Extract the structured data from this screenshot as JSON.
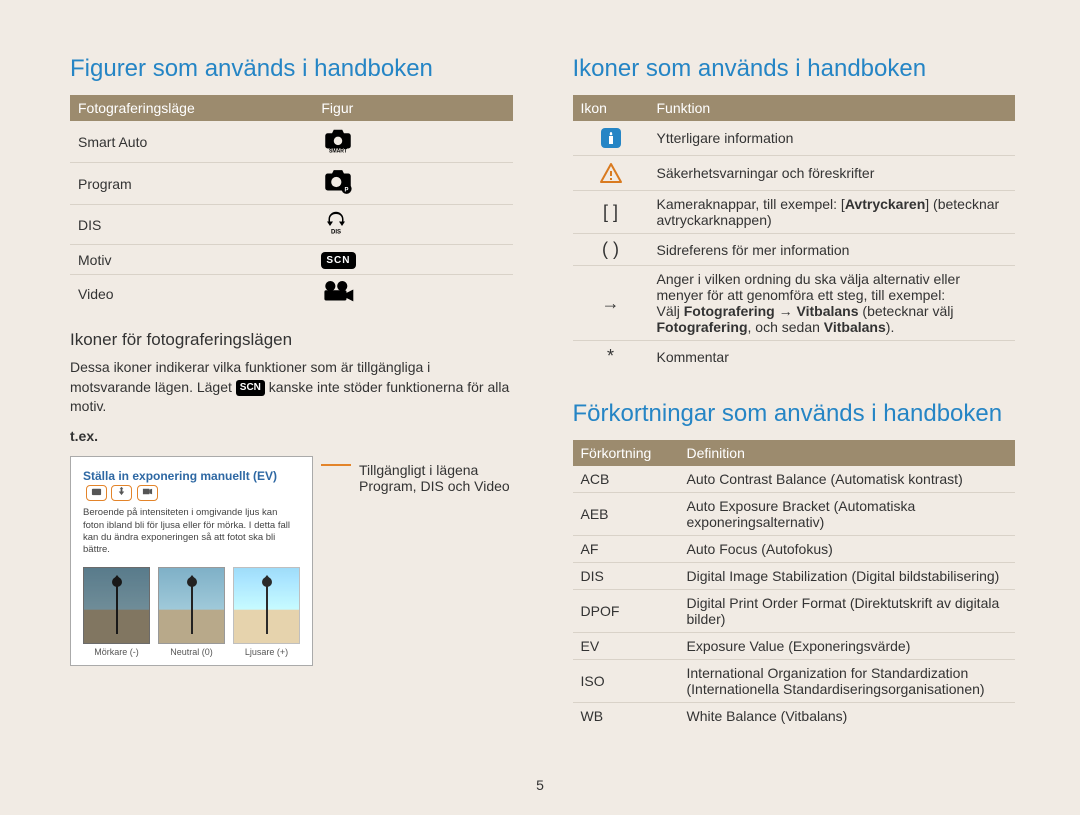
{
  "pageNumber": "5",
  "left": {
    "heading": "Figurer som används i handboken",
    "table1": {
      "headers": [
        "Fotograferingsläge",
        "Figur"
      ],
      "rows": [
        {
          "mode": "Smart Auto",
          "figKey": "smart"
        },
        {
          "mode": "Program",
          "figKey": "program"
        },
        {
          "mode": "DIS",
          "figKey": "dis"
        },
        {
          "mode": "Motiv",
          "figKey": "scn"
        },
        {
          "mode": "Video",
          "figKey": "video"
        }
      ]
    },
    "subheading": "Ikoner för fotograferingslägen",
    "paragraph_before": "Dessa ikoner indikerar vilka funktioner som är tillgängliga i motsvarande lägen. Läget ",
    "paragraph_scn_chip": "SCN",
    "paragraph_after": " kanske inte stöder funktionerna för alla motiv.",
    "example_label": "t.ex.",
    "example": {
      "title": "Ställa in exponering manuellt (EV)",
      "desc": "Beroende på intensiteten i omgivande ljus kan foton ibland bli för ljusa eller för mörka. I detta fall kan du ändra exponeringen så att fotot ska bli bättre.",
      "thumbs": [
        {
          "label": "Mörkare (-)"
        },
        {
          "label": "Neutral (0)"
        },
        {
          "label": "Ljusare (+)"
        }
      ]
    },
    "callout": "Tillgängligt i lägena Program, DIS och Video"
  },
  "right": {
    "heading1": "Ikoner som används i handboken",
    "iconTable": {
      "headers": [
        "Ikon",
        "Funktion"
      ],
      "rows": [
        {
          "iconKey": "info",
          "text": "Ytterligare information"
        },
        {
          "iconKey": "warn",
          "text": "Säkerhetsvarningar och föreskrifter"
        },
        {
          "iconKey": "brackets",
          "html": "Kameraknappar, till exempel: [<b>Avtryckaren</b>] (betecknar avtryckarknappen)"
        },
        {
          "iconKey": "paren",
          "text": "Sidreferens för mer information"
        },
        {
          "iconKey": "arrow",
          "html": "Anger i vilken ordning du ska välja alternativ eller menyer för att genomföra ett steg, till exempel:<br>Välj <b>Fotografering</b> → <b>Vitbalans</b> (betecknar välj <b>Fotografering</b>, och sedan <b>Vitbalans</b>)."
        },
        {
          "iconKey": "star",
          "text": "Kommentar"
        }
      ]
    },
    "heading2": "Förkortningar som används i handboken",
    "abbrTable": {
      "headers": [
        "Förkortning",
        "Definition"
      ],
      "rows": [
        {
          "abbr": "ACB",
          "def": "Auto Contrast Balance (Automatisk kontrast)"
        },
        {
          "abbr": "AEB",
          "def": "Auto Exposure Bracket (Automatiska exponeringsalternativ)"
        },
        {
          "abbr": "AF",
          "def": "Auto Focus (Autofokus)"
        },
        {
          "abbr": "DIS",
          "def": "Digital Image Stabilization (Digital bildstabilisering)"
        },
        {
          "abbr": "DPOF",
          "def": "Digital Print Order Format (Direktutskrift av digitala bilder)"
        },
        {
          "abbr": "EV",
          "def": "Exposure Value (Exponeringsvärde)"
        },
        {
          "abbr": "ISO",
          "def": "International Organization for Standardization (Internationella Standardiseringsorganisationen)"
        },
        {
          "abbr": "WB",
          "def": "White Balance (Vitbalans)"
        }
      ]
    }
  },
  "iconSymbols": {
    "brackets": "[ ]",
    "paren": "( )",
    "arrow": "→",
    "star": "*"
  }
}
